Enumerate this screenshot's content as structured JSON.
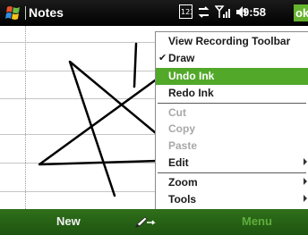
{
  "titlebar": {
    "app_title": "Notes",
    "clock": "9:58",
    "ok_label": "ok",
    "icons": [
      "windows-start-icon",
      "keypad-icon",
      "connectivity-icon",
      "signal-icon",
      "volume-icon"
    ]
  },
  "menu": {
    "items": [
      {
        "label": "View Recording Toolbar",
        "state": "normal",
        "checked": false,
        "submenu": false
      },
      {
        "label": "Draw",
        "state": "normal",
        "checked": true,
        "submenu": false
      },
      {
        "label": "Undo Ink",
        "state": "selected",
        "checked": false,
        "submenu": false
      },
      {
        "label": "Redo Ink",
        "state": "normal",
        "checked": false,
        "submenu": false
      },
      {
        "label": "Cut",
        "state": "disabled",
        "checked": false,
        "submenu": false
      },
      {
        "label": "Copy",
        "state": "disabled",
        "checked": false,
        "submenu": false
      },
      {
        "label": "Paste",
        "state": "disabled",
        "checked": false,
        "submenu": false
      },
      {
        "label": "Edit",
        "state": "normal",
        "checked": false,
        "submenu": true
      },
      {
        "label": "Zoom",
        "state": "normal",
        "checked": false,
        "submenu": true
      },
      {
        "label": "Tools",
        "state": "normal",
        "checked": false,
        "submenu": true
      }
    ],
    "check_glyph": "✔"
  },
  "softkeys": {
    "left": "New",
    "right": "Menu",
    "center_icon": "input-panel-icon"
  },
  "colors": {
    "selection": "#52a829",
    "softbar": "#2a6516",
    "ok": "#66b32e"
  }
}
